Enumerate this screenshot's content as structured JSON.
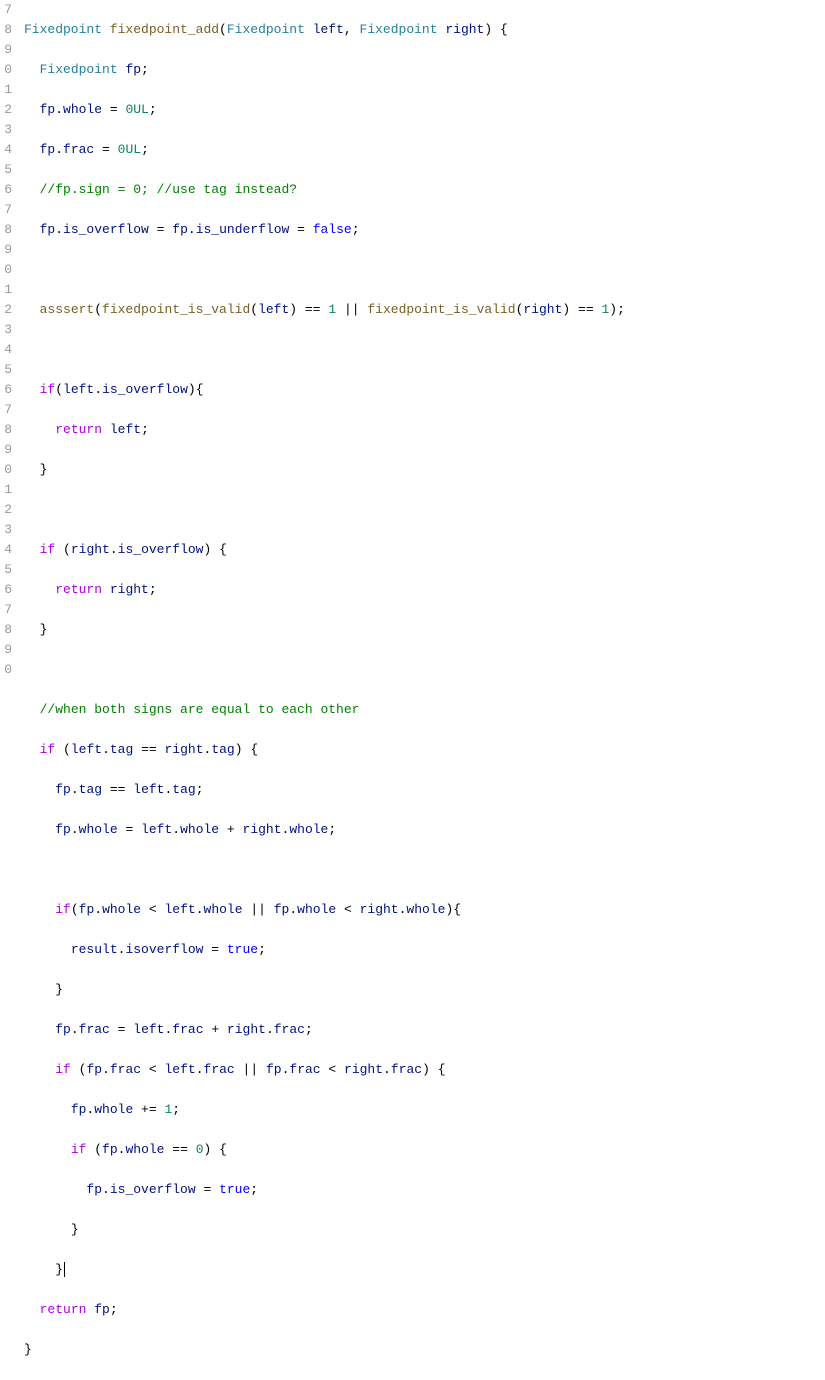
{
  "gutter": [
    "7",
    "8",
    "9",
    "0",
    "1",
    "2",
    "3",
    "4",
    "5",
    "6",
    "7",
    "8",
    "9",
    "0",
    "1",
    "2",
    "3",
    "4",
    "5",
    "6",
    "7",
    "8",
    "9",
    "0",
    "1",
    "2",
    "3",
    "4",
    "5",
    "6",
    "7",
    "8",
    "9",
    "0"
  ],
  "tokens": {
    "t_Fixedpoint": "Fixedpoint",
    "t_fixedpoint_add": "fixedpoint_add",
    "t_left": "left",
    "t_right": "right",
    "t_fp": "fp",
    "t_whole": "whole",
    "t_frac": "frac",
    "t_0UL": "0UL",
    "t_comment_sign": "//fp.sign = 0; //use tag instead?",
    "t_is_overflow": "is_overflow",
    "t_is_underflow": "is_underflow",
    "t_false": "false",
    "t_asssert": "asssert",
    "t_fixedpoint_is_valid": "fixedpoint_is_valid",
    "t_if": "if",
    "t_return": "return",
    "t_comment_signs": "//when both signs are equal to each other",
    "t_tag": "tag",
    "t_result": "result",
    "t_isoverflow": "isoverflow",
    "t_true": "true",
    "t_1": "1",
    "t_0": "0",
    "t_plus_eq_1": " += ",
    "t_eq": " = ",
    "t_eqeq": " == ",
    "t_plus": " + ",
    "t_lt": " < ",
    "t_or": " || ",
    "t_semi": ";",
    "t_comma": ", ",
    "t_lp": "(",
    "t_rp": ")",
    "t_lb": "{",
    "t_rb": "}",
    "t_dot": ".",
    "t_sp1": " ",
    "t_ind1": "  ",
    "t_ind2": "    ",
    "t_ind3": "      ",
    "t_ind4": "        "
  }
}
